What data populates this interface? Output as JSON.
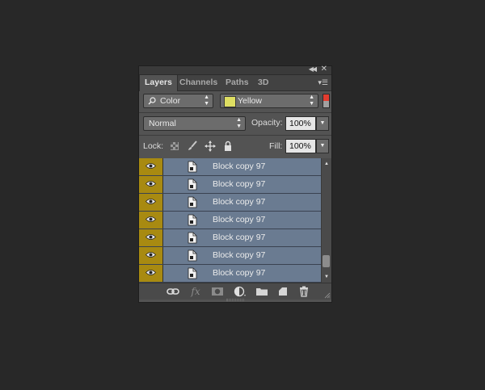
{
  "panel": {
    "tabs": [
      {
        "label": "Layers",
        "active": true
      },
      {
        "label": "Channels",
        "active": false
      },
      {
        "label": "Paths",
        "active": false
      },
      {
        "label": "3D",
        "active": false
      }
    ],
    "filter": {
      "kind_label": "Color",
      "color_value": "Yellow",
      "color_swatch": "#dede62"
    },
    "blend_mode": "Normal",
    "opacity_label": "Opacity:",
    "opacity_value": "100%",
    "lock_label": "Lock:",
    "fill_label": "Fill:",
    "fill_value": "100%",
    "layer_color_tag": "#a88a11",
    "layer_selected_color": "#6a7b91",
    "layers": [
      {
        "name": "Block copy 97"
      },
      {
        "name": "Block copy 97"
      },
      {
        "name": "Block copy 97"
      },
      {
        "name": "Block copy 97"
      },
      {
        "name": "Block copy 97"
      },
      {
        "name": "Block copy 97"
      },
      {
        "name": "Block copy 97"
      }
    ],
    "footer_icons": [
      "link-icon",
      "fx-icon",
      "mask-icon",
      "adjustment-icon",
      "group-folder-icon",
      "new-layer-icon",
      "trash-icon"
    ]
  }
}
